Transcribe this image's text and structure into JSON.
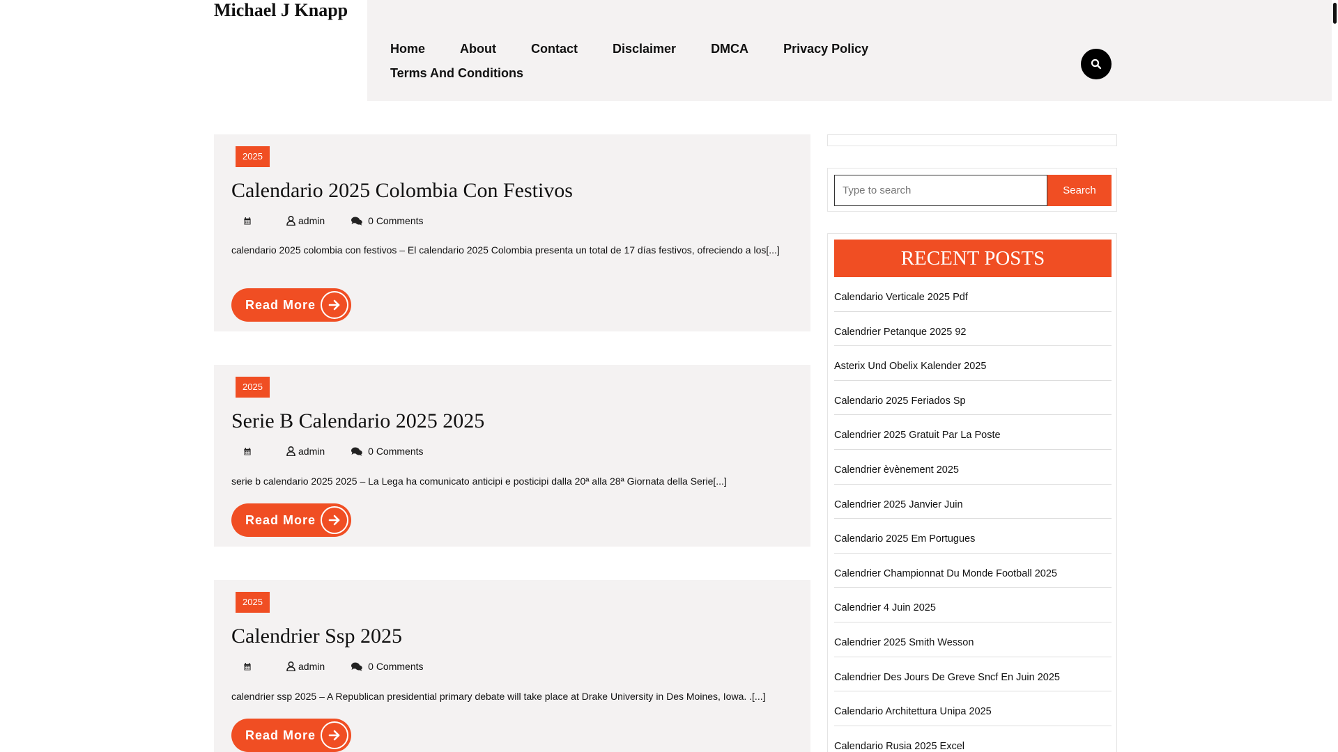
{
  "site": {
    "title": "Michael J Knapp"
  },
  "nav": {
    "items": [
      "Home",
      "About",
      "Contact",
      "Disclaimer",
      "DMCA",
      "Privacy Policy",
      "Terms And Conditions"
    ]
  },
  "posts": [
    {
      "category": "2025",
      "title": "Calendario 2025 Colombia Con Festivos",
      "author": "admin",
      "comments": "0 Comments",
      "excerpt": "calendario 2025 colombia con festivos – El calendario 2025 Colombia presenta un total de 17 días festivos, ofreciendo a los[...]",
      "read_more": "Read More"
    },
    {
      "category": "2025",
      "title": "Serie B Calendario 2025 2025",
      "author": "admin",
      "comments": "0 Comments",
      "excerpt": "serie b calendario 2025 2025 – La Lega ha comunicato anticipi e posticipi dalla 20ª alla 28ª Giornata della Serie[...]",
      "read_more": "Read More"
    },
    {
      "category": "2025",
      "title": "Calendrier Ssp 2025",
      "author": "admin",
      "comments": "0 Comments",
      "excerpt": "calendrier ssp 2025 – A Republican presidential primary debate will take place at Drake University in Des Moines, Iowa. .[...]",
      "read_more": "Read More"
    }
  ],
  "sidebar": {
    "search": {
      "placeholder": "Type to search",
      "button": "Search"
    },
    "recent_title": "RECENT POSTS",
    "recent_posts": [
      "Calendario Verticale 2025 Pdf",
      "Calendrier Petanque 2025 92",
      "Asterix Und Obelix Kalender 2025",
      "Calendario 2025 Feriados Sp",
      "Calendrier 2025 Gratuit Par La Poste",
      "Calendrier èvènement 2025",
      "Calendrier 2025 Janvier Juin",
      "Calendario 2025 Em Portugues",
      "Calendrier Championnat Du Monde Football 2025",
      "Calendrier 4 Juin 2025",
      "Calendrier 2025 Smith Wesson",
      "Calendrier Des Jours De Greve Sncf En Juin 2025",
      "Calendario Architettura Unipa 2025",
      "Calendario Rusia 2025 Excel"
    ]
  },
  "colors": {
    "accent": "#f04e23",
    "panel": "#f4f2f2"
  },
  "icons": {
    "header_search": "search-icon",
    "meta": [
      "calendar-icon",
      "user-icon",
      "comments-icon"
    ],
    "read_more": "arrow-right-icon"
  }
}
